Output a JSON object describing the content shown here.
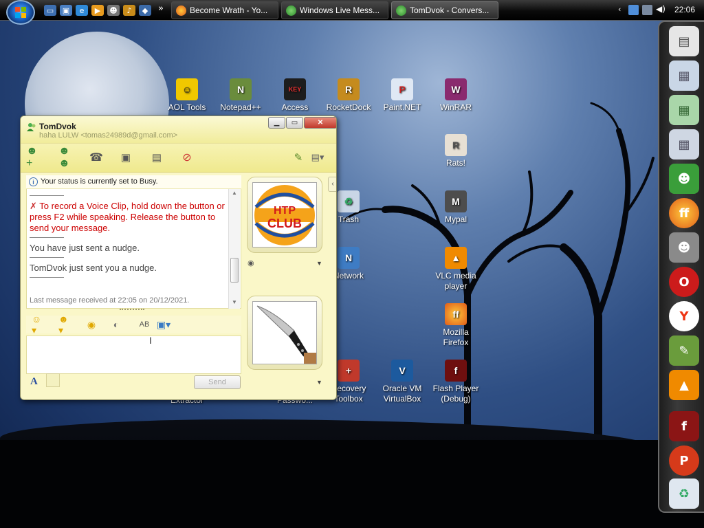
{
  "taskbar": {
    "buttons": [
      {
        "label": "Become Wrath - Yo...",
        "icon": "firefox-icon"
      },
      {
        "label": "Windows Live Mess...",
        "icon": "messenger-icon"
      },
      {
        "label": "TomDvok - Convers...",
        "icon": "messenger-icon"
      }
    ],
    "clock": "22:06",
    "more": "»"
  },
  "desktop_icons": [
    {
      "label": "AOL Tools",
      "glyph": "☺",
      "color": "#f0c800"
    },
    {
      "label": "Notepad++",
      "glyph": "N",
      "color": "#6a8c3c"
    },
    {
      "label": "Access",
      "glyph": "KEY",
      "color": "#1d1d1d"
    },
    {
      "label": "RocketDock",
      "glyph": "R",
      "color": "#c58b1e"
    },
    {
      "label": "Paint.NET",
      "glyph": "P",
      "color": "#dfe8f4"
    },
    {
      "label": "WinRAR",
      "glyph": "W",
      "color": "#8a2a6e"
    },
    {
      "label": "Rats!",
      "glyph": "R",
      "color": "#e8e0d4"
    },
    {
      "label": "Trash",
      "glyph": "♻",
      "color": "#c9d6e6"
    },
    {
      "label": "Mypal",
      "glyph": "M",
      "color": "#4d4d4d"
    },
    {
      "label": "Network",
      "glyph": "N",
      "color": "#3e7cc4"
    },
    {
      "label": "VLC media player",
      "glyph": "▲",
      "color": "#f08a00"
    },
    {
      "label": "Mozilla Firefox",
      "glyph": "ff",
      "color": "#e0641a"
    },
    {
      "label": "Recovery Toolbox",
      "glyph": "+",
      "color": "#c0392b"
    },
    {
      "label": "Oracle VM VirtualBox",
      "glyph": "V",
      "color": "#1c5a9e"
    },
    {
      "label": "Flash Player (Debug)",
      "glyph": "f",
      "color": "#6e0f0f"
    },
    {
      "label": "Extractor",
      "glyph": "",
      "color": "#000000"
    },
    {
      "label": "Passwo...",
      "glyph": "",
      "color": "#000000"
    }
  ],
  "dock": [
    {
      "name": "printer",
      "glyph": "▤",
      "color": "#e6e6e6"
    },
    {
      "name": "documents-folder",
      "glyph": "▦",
      "color": "#c9d6e6"
    },
    {
      "name": "green-folder",
      "glyph": "▦",
      "color": "#a9d6a9"
    },
    {
      "name": "pictures-folder",
      "glyph": "▦",
      "color": "#cfd7e3"
    },
    {
      "name": "messenger",
      "glyph": "☻",
      "color": "#3a9e3a"
    },
    {
      "name": "firefox",
      "glyph": "ff",
      "color": "#e0641a"
    },
    {
      "name": "raccoon",
      "glyph": "☻",
      "color": "#8a8a8a"
    },
    {
      "name": "opera",
      "glyph": "O",
      "color": "#cc1b1b"
    },
    {
      "name": "yandex",
      "glyph": "Y",
      "color": "#ffffff"
    },
    {
      "name": "notepad",
      "glyph": "✎",
      "color": "#6a9c3c"
    },
    {
      "name": "vlc",
      "glyph": "▲",
      "color": "#f08a00"
    },
    {
      "name": "flash",
      "glyph": "f",
      "color": "#8b1515"
    },
    {
      "name": "p-app",
      "glyph": "P",
      "color": "#d63a1a"
    },
    {
      "name": "recycle-bin",
      "glyph": "♻",
      "color": "#dfe7f0"
    }
  ],
  "messenger": {
    "contact_name": "TomDvok",
    "contact_sub": "haha LULW <tomas24989d@gmail.com>",
    "status_text": "Your status is currently set to Busy.",
    "voice_clip_text": "To record a Voice Clip, hold down the button or press F2 while speaking. Release the button to send your message.",
    "sent_nudge": "You have just sent a nudge.",
    "received_nudge": "TomDvok just sent you a nudge.",
    "last_message": "Last message received at 22:05 on 20/12/2021.",
    "send_label": "Send",
    "display_pic_text": "HTP CLUB",
    "format_letter": "A"
  },
  "colors": {
    "accent_red": "#cc0000",
    "window_yellow": "#faf7c8"
  }
}
